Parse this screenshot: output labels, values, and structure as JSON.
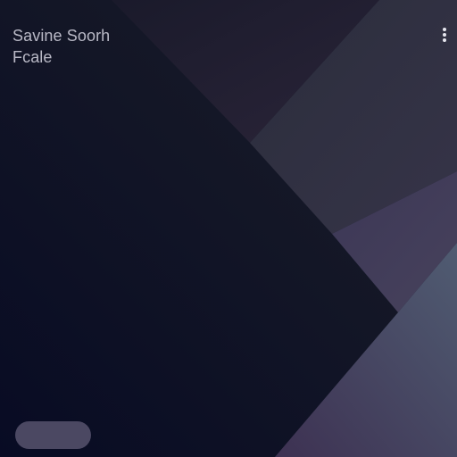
{
  "screen": {
    "title_line_1": "Savine Soorh",
    "title_line_2": "Fcale"
  },
  "menu": {
    "icon": "more-vertical-icon"
  },
  "pill_button": {
    "label": ""
  },
  "colors": {
    "background_dark": "#0c1022",
    "text_muted": "#b9b9c6",
    "pill": "#4b4862",
    "accent_purple": "#3c3456",
    "accent_teal": "#4a5470"
  }
}
